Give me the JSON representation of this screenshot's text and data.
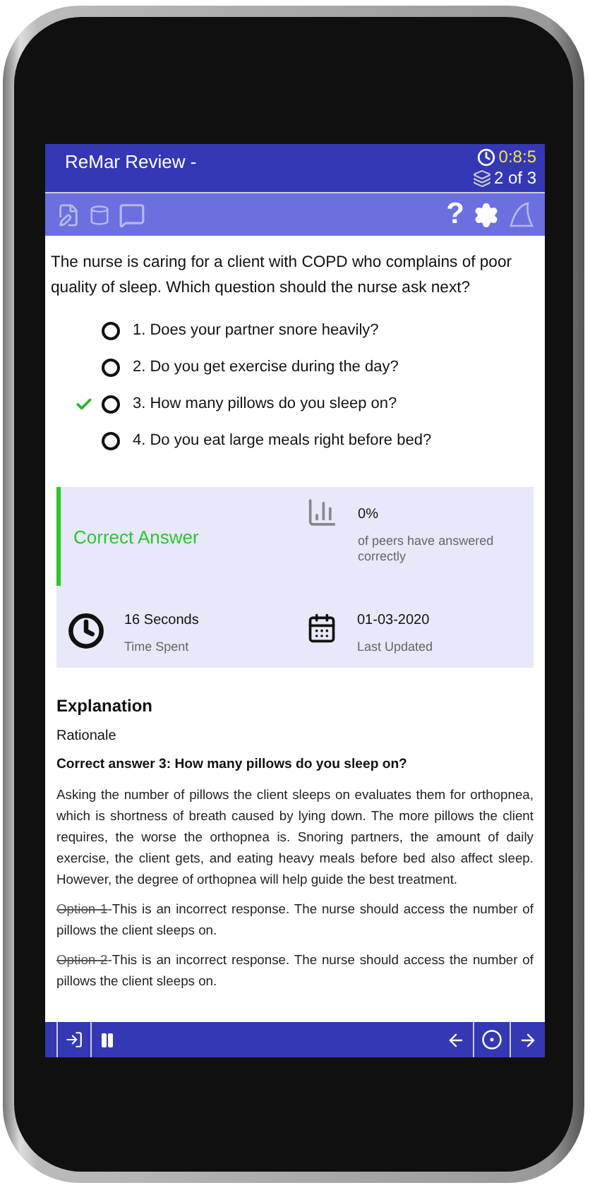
{
  "header": {
    "title": "ReMar Review -",
    "timer": "0:8:5",
    "progress": "2 of 3"
  },
  "toolbar": {
    "help": "?"
  },
  "question": {
    "text": "The nurse is caring for a client with COPD who complains of poor quality of sleep. Which question should the nurse ask next?",
    "options": [
      {
        "label": "1. Does your partner snore heavily?",
        "selected": false,
        "correct": false
      },
      {
        "label": "2. Do you get exercise during the day?",
        "selected": false,
        "correct": false
      },
      {
        "label": "3. How many pillows do you sleep on?",
        "selected": false,
        "correct": true
      },
      {
        "label": "4. Do you eat large meals right before bed?",
        "selected": false,
        "correct": false
      }
    ]
  },
  "result": {
    "status": "Correct Answer",
    "correct": true,
    "peer_percent": "0%",
    "peer_caption": "of peers have answered correctly",
    "time_value": "16 Seconds",
    "time_caption": "Time Spent",
    "date_value": "01-03-2020",
    "date_caption": "Last Updated"
  },
  "explanation": {
    "heading": "Explanation",
    "subheading": "Rationale",
    "answer": "Correct answer 3: How many pillows do you sleep on?",
    "body": "Asking the number of pillows the client sleeps on evaluates them for orthopnea, which is shortness of breath caused by lying down. The more pillows the client requires, the worse the orthopnea is. Snoring partners, the amount of daily exercise, the client gets, and eating heavy meals before bed also affect sleep. However, the degree of orthopnea will help guide the best treatment.",
    "options": [
      {
        "label": "Option 1",
        "text": "-This is an incorrect response. The nurse should access the number of pillows the client sleeps on."
      },
      {
        "label": "Option 2",
        "text": "-This is an incorrect response. The nurse should access the number of pillows the client sleeps on."
      }
    ]
  }
}
